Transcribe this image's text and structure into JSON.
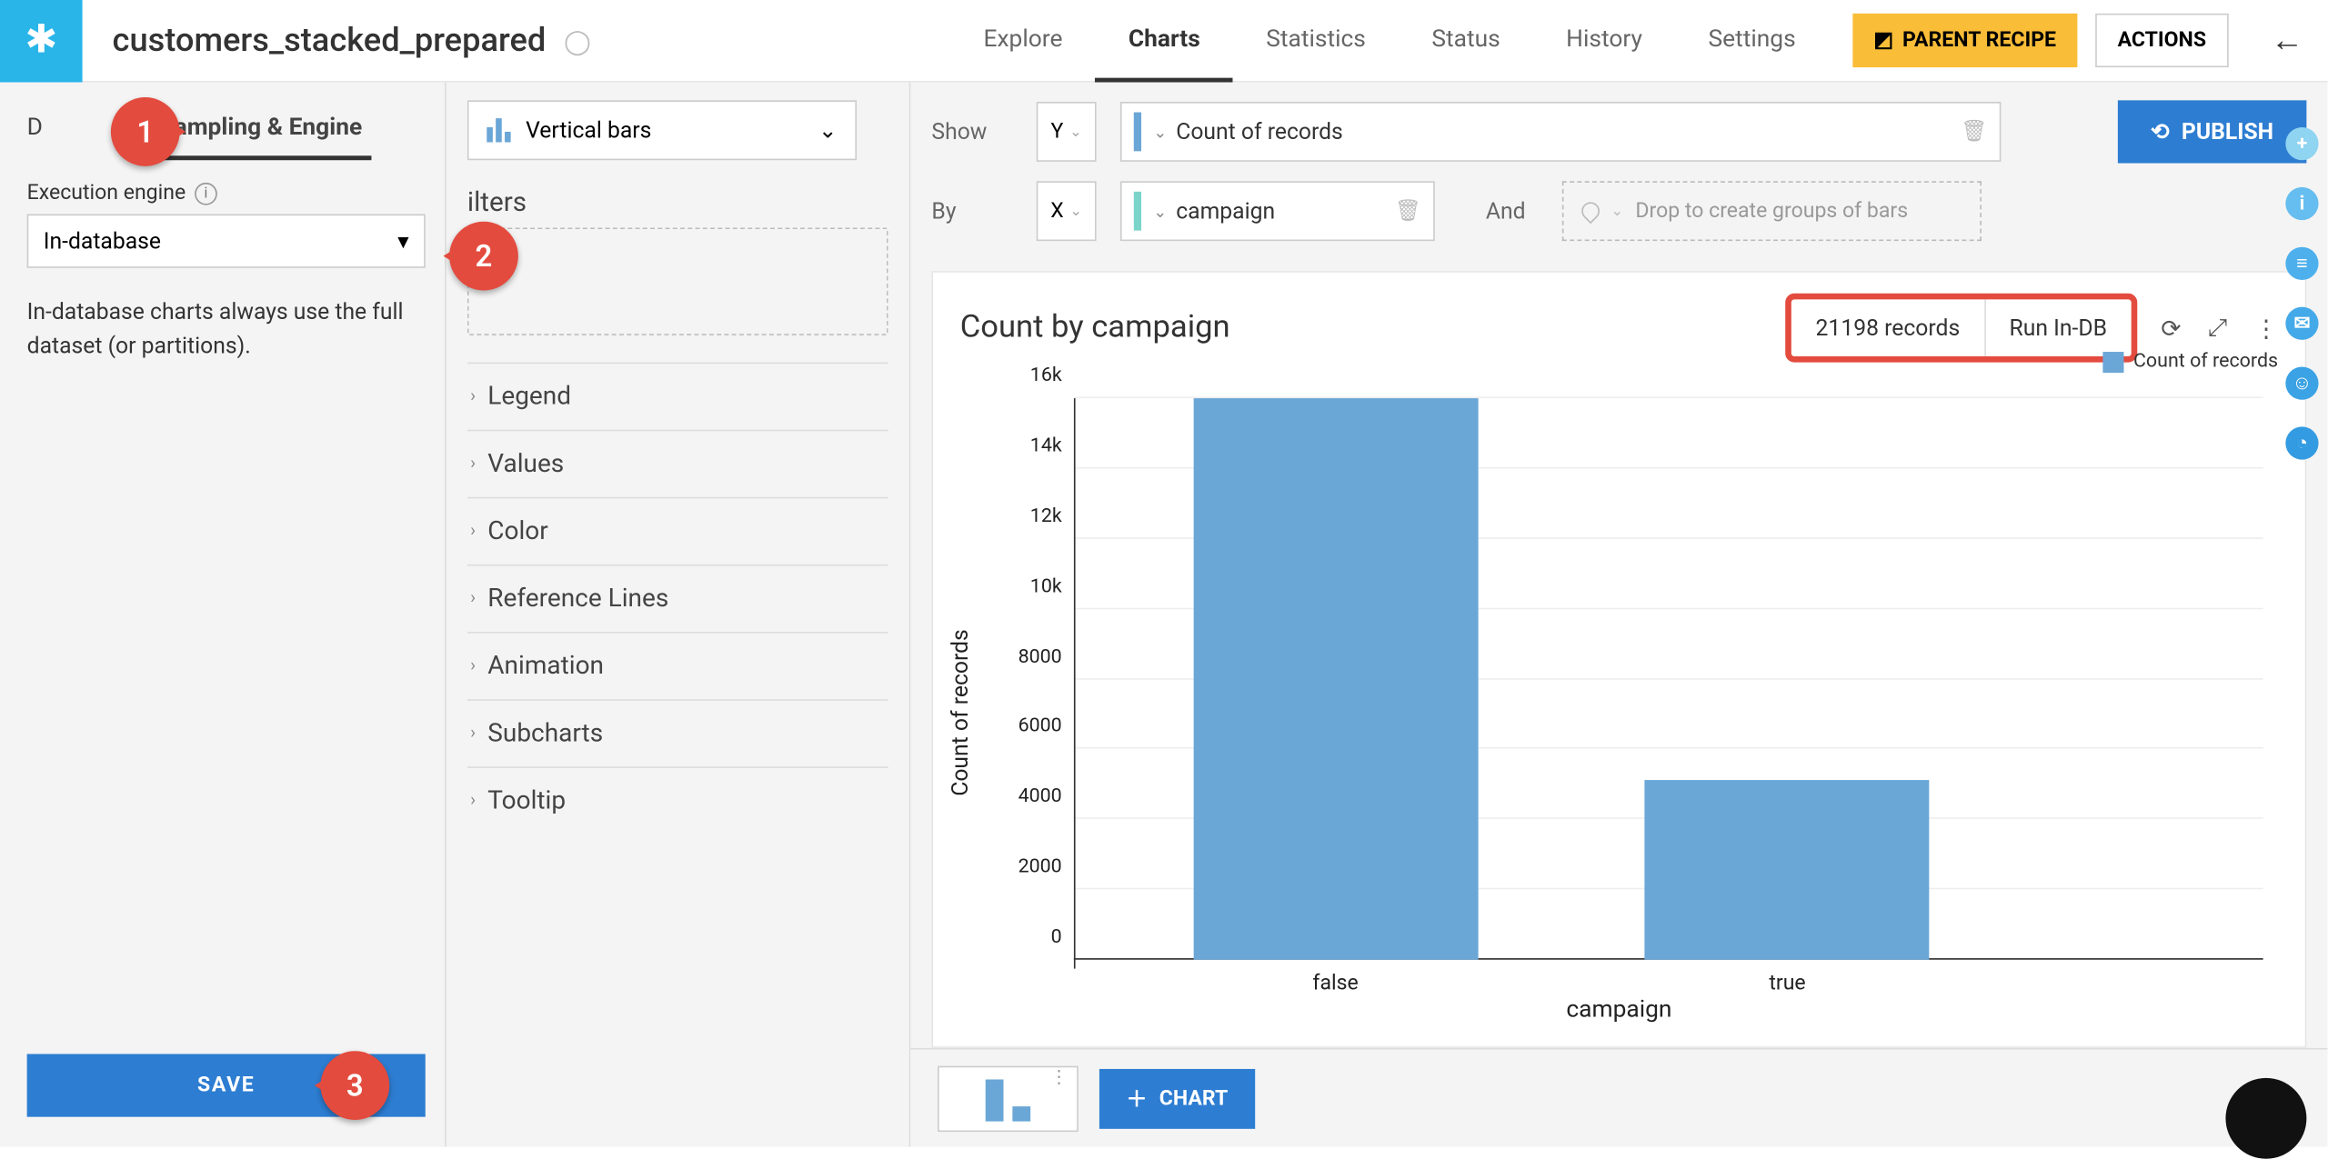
{
  "header": {
    "title": "customers_stacked_prepared",
    "nav": [
      "Explore",
      "Charts",
      "Statistics",
      "Status",
      "History",
      "Settings"
    ],
    "active_nav": "Charts",
    "parent_recipe": "PARENT RECIPE",
    "actions": "ACTIONS"
  },
  "left": {
    "tab_d": "D",
    "tab_sampling": "Sampling & Engine",
    "exec_label": "Execution engine",
    "exec_value": "In-database",
    "hint": "In-database charts always use the full dataset (or partitions).",
    "save": "SAVE"
  },
  "mid": {
    "chart_type": "Vertical bars",
    "filters_title": "ilters",
    "accordion": [
      "Legend",
      "Values",
      "Color",
      "Reference Lines",
      "Animation",
      "Subcharts",
      "Tooltip"
    ]
  },
  "cfg": {
    "show_label": "Show",
    "by_label": "By",
    "and_label": "And",
    "y_axis": "Y",
    "x_axis": "X",
    "y_metric": "Count of records",
    "x_metric": "campaign",
    "group_placeholder": "Drop to create groups of bars",
    "publish": "PUBLISH"
  },
  "chart": {
    "title": "Count by campaign",
    "records": "21198 records",
    "run": "Run In-DB",
    "legend": "Count of records",
    "xlabel": "campaign",
    "ylabel": "Count of records"
  },
  "bottom": {
    "chart_button": "CHART"
  },
  "callouts": {
    "c1": "1",
    "c2": "2",
    "c3": "3"
  },
  "chart_data": {
    "type": "bar",
    "title": "Count by campaign",
    "categories": [
      "false",
      "true"
    ],
    "values": [
      16000,
      5100
    ],
    "xlabel": "campaign",
    "ylabel": "Count of records",
    "ylim": [
      0,
      16000
    ],
    "yticks": [
      0,
      2000,
      4000,
      6000,
      8000,
      10000,
      12000,
      14000,
      16000
    ],
    "ytick_labels": [
      "0",
      "2000",
      "4000",
      "6000",
      "8000",
      "10k",
      "12k",
      "14k",
      "16k"
    ],
    "legend": [
      "Count of records"
    ]
  }
}
